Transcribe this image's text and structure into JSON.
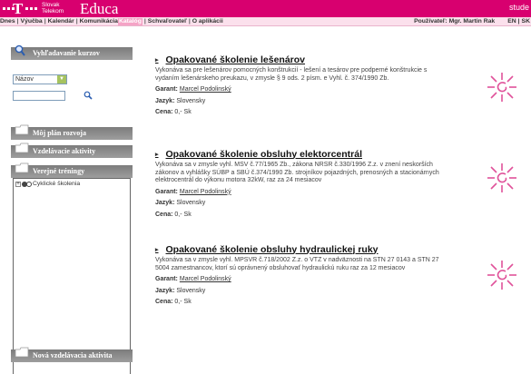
{
  "brand": {
    "company_line1": "Slovak",
    "company_line2": "Telekom",
    "app_name": "Educa",
    "right_text": "stude"
  },
  "menu": {
    "items": [
      "Dnes",
      "Výučba",
      "Kalendár",
      "Komunikácia",
      "Katalóg",
      "Schvaľovateľ",
      "O aplikácii"
    ],
    "active_index": 4,
    "user_label": "Používateľ: Mgr. Martin Rak",
    "languages": [
      "EN",
      "SK"
    ]
  },
  "sidebar": {
    "search": {
      "title": "Vyhľadavanie kurzov",
      "select_value": "Názov",
      "input_value": ""
    },
    "plan_title": "Môj plán rozvoja",
    "activities_title": "Vzdelávacie aktivity",
    "public_title": "Verejné tréningy",
    "tree_items": [
      "Cyklické školenia"
    ],
    "new_activity_title": "Nová vzdelávacia aktivita"
  },
  "courses": [
    {
      "title": "Opakované školenie lešenárov",
      "description": "Vykonáva sa pre lešenárov pomocných konštrukcií - lešení a tesárov pre podperné konštrukcie s vydaním lešenárskeho preukazu, v zmysle § 9 ods. 2 písm. e Vyhl. č. 374/1990 Zb.",
      "garant_label": "Garant:",
      "garant": "Marcel Podolinský",
      "language_label": "Jazyk:",
      "language": "Slovensky",
      "price_label": "Cena:",
      "price": "0,- Sk"
    },
    {
      "title": "Opakované školenie obsluhy elektorcentrál",
      "description": "Vykonáva sa v zmysle vyhl. MSV č.77/1965 Zb., zákona NRSR č.330/1996 Z.z. v znení neskorších zákonov a vyhlášky SÚBP a SBÚ č.374/1990 Zb. strojníkov pojazdných, prenosných a stacionárnych elektrocentrál do výkonu motora 32kW, raz za 24 mesiacov",
      "garant_label": "Garant:",
      "garant": "Marcel Podolinský",
      "language_label": "Jazyk:",
      "language": "Slovensky",
      "price_label": "Cena:",
      "price": "0,- Sk"
    },
    {
      "title": "Opakované školenie obsluhy hydraulickej ruky",
      "description": "Vykonáva sa v zmysle vyhl. MPSVR č.718/2002 Z.z. o VTZ v nadväznosti na STN 27 0143 a STN 27 5004 zamestnancov, ktorí sú oprávnený obsluhovať hydraulickú ruku raz za 12 mesiacov",
      "garant_label": "Garant:",
      "garant": "Marcel Podolinský",
      "language_label": "Jazyk:",
      "language": "Slovensky",
      "price_label": "Cena:",
      "price": "0,- Sk"
    }
  ],
  "colors": {
    "brand": "#d8006f",
    "menu_bg": "#fbe0ec",
    "panel": "#8a8a8a",
    "logo": "#e0529a"
  },
  "icons": {
    "search": "magnifier-icon",
    "folder": "folder-icon",
    "logo": "educa-flower-logo"
  }
}
